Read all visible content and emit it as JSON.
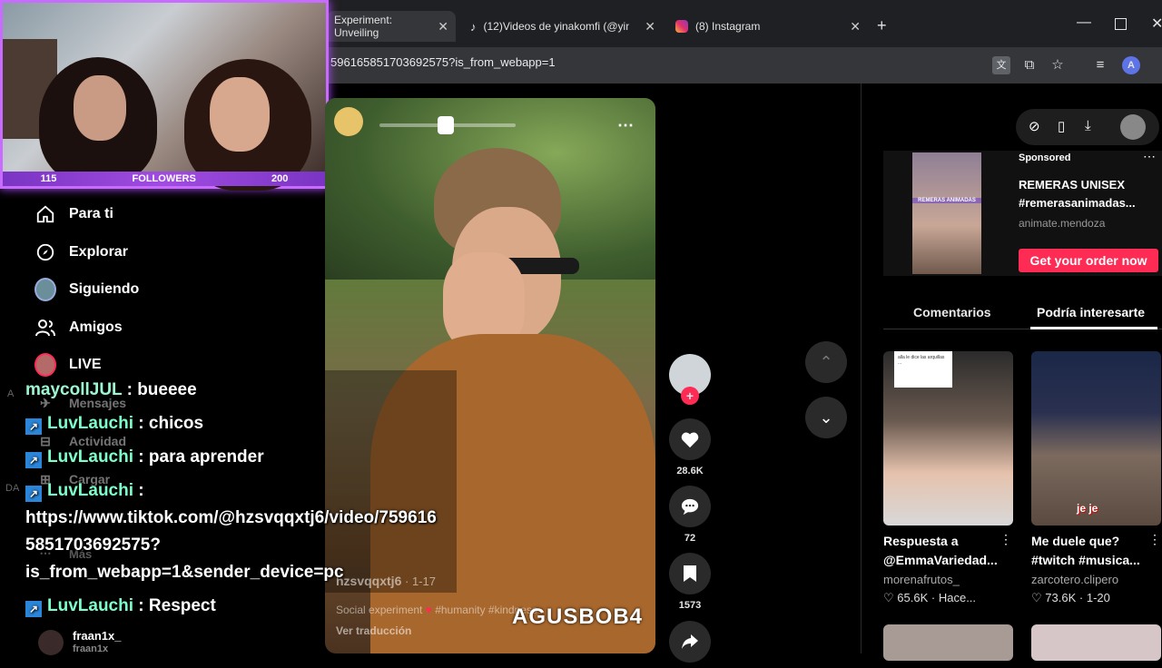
{
  "browser": {
    "tabs": [
      {
        "title": "Experiment: Unveiling",
        "active": true
      },
      {
        "title": "(12)Videos de yinakomfi (@yin",
        "active": false
      },
      {
        "title": "(8) Instagram",
        "active": false
      }
    ],
    "url": "596165851703692575?is_from_webapp=1",
    "profile_initial": "A",
    "new_tab": "+"
  },
  "webcam": {
    "followers_label": "FOLLOWERS",
    "current": "115",
    "goal": "200"
  },
  "sidebar": {
    "items": [
      {
        "label": "Para ti",
        "icon": "home-icon"
      },
      {
        "label": "Explorar",
        "icon": "compass-icon"
      },
      {
        "label": "Siguiendo",
        "icon": "avatar-icon"
      },
      {
        "label": "Amigos",
        "icon": "friends-icon"
      },
      {
        "label": "LIVE",
        "icon": "live-icon"
      },
      {
        "label": "Mensajes",
        "icon": "messages-icon"
      },
      {
        "label": "Actividad",
        "icon": "activity-icon"
      },
      {
        "label": "Cargar",
        "icon": "upload-icon"
      },
      {
        "label": "Más",
        "icon": "more-icon"
      }
    ],
    "following": {
      "name": "fraan1x_",
      "handle": "fraan1x"
    }
  },
  "video": {
    "author": "hzsvqqxtj6",
    "date": "1-17",
    "caption": "Social experiment",
    "hashtags": "#humanity #kindness",
    "translate": "Ver traducción",
    "watermark": "AGUSBOB4"
  },
  "actions": {
    "likes": "28.6K",
    "comments": "72",
    "saves": "1573"
  },
  "chat": [
    {
      "user": "maycollJUL",
      "text": " : bueeee",
      "badge": false
    },
    {
      "user": "LuvLauchi",
      "text": " : chicos",
      "badge": true
    },
    {
      "user": "LuvLauchi",
      "text": " : para aprender",
      "badge": true
    },
    {
      "user": "LuvLauchi",
      "text": " :",
      "badge": true
    },
    {
      "line": "https://www.tiktok.com/@hzsvqqxtj6/video/759616"
    },
    {
      "line": "5851703692575?"
    },
    {
      "line": "is_from_webapp=1&sender_device=pc"
    },
    {
      "user": "LuvLauchi",
      "text": " : Respect",
      "badge": true
    }
  ],
  "ad": {
    "sponsored": "Sponsored",
    "title": "REMERAS UNISEX #remerasanimadas...",
    "handle": "animate.mendoza",
    "cta": "Get your order now",
    "thumb_text": "REMERAS ANIMADAS"
  },
  "tabs": {
    "comments": "Comentarios",
    "related": "Podría interesarte"
  },
  "related": [
    {
      "title": "Respuesta a @EmmaVariedad...",
      "author": "morenafrutos_",
      "likes": "65.6K",
      "date": "Hace...",
      "overlay": "alla le dice las arquillas ..."
    },
    {
      "title": "Me duele que? #twitch #musica...",
      "author": "zarcotero.clipero",
      "likes": "73.6K",
      "date": "1-20",
      "overlay": "je je"
    }
  ],
  "colors": {
    "accent_red": "#fe2c55",
    "chat_user": "#7dffc9",
    "webcam_border": "#c86cff"
  }
}
